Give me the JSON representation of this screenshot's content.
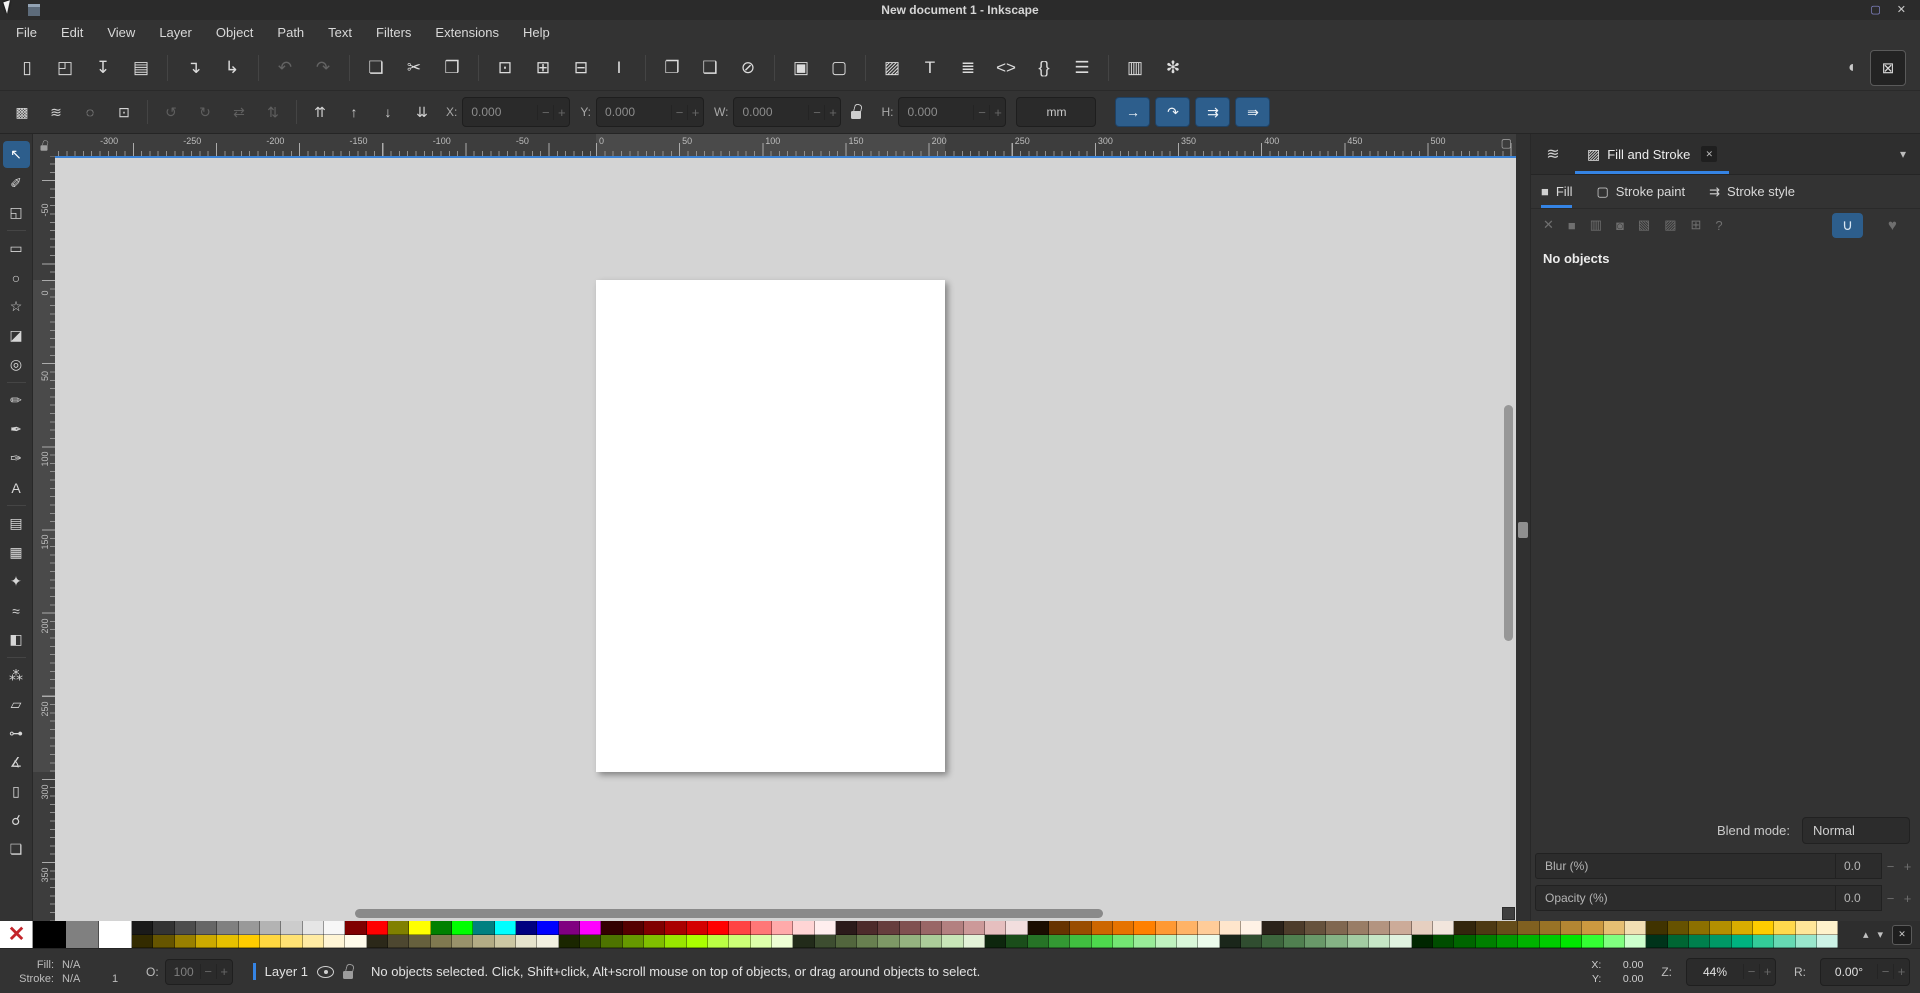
{
  "window": {
    "title": "New document 1 - Inkscape",
    "restore_icon": "▢",
    "close_icon": "✕"
  },
  "menubar": {
    "items": [
      "File",
      "Edit",
      "View",
      "Layer",
      "Object",
      "Path",
      "Text",
      "Filters",
      "Extensions",
      "Help"
    ]
  },
  "ui_icons": {
    "minus": "−",
    "plus": "+"
  },
  "command_toolbar": {
    "groups": [
      [
        {
          "name": "new-document",
          "glyph": "▯"
        },
        {
          "name": "open",
          "glyph": "◰"
        },
        {
          "name": "save",
          "glyph": "↧"
        },
        {
          "name": "print",
          "glyph": "▤"
        }
      ],
      [
        {
          "name": "import",
          "glyph": "↴"
        },
        {
          "name": "export",
          "glyph": "↳"
        }
      ],
      [
        {
          "name": "undo",
          "glyph": "↶",
          "disabled": true
        },
        {
          "name": "redo",
          "glyph": "↷",
          "disabled": true
        }
      ],
      [
        {
          "name": "copy",
          "glyph": "❏"
        },
        {
          "name": "cut",
          "glyph": "✂"
        },
        {
          "name": "paste",
          "glyph": "❒"
        }
      ],
      [
        {
          "name": "zoom-selection",
          "glyph": "⊡"
        },
        {
          "name": "zoom-drawing",
          "glyph": "⊞"
        },
        {
          "name": "zoom-page",
          "glyph": "⊟"
        },
        {
          "name": "zoom-page-width",
          "glyph": "I"
        }
      ],
      [
        {
          "name": "duplicate",
          "glyph": "❐"
        },
        {
          "name": "clone",
          "glyph": "❑"
        },
        {
          "name": "unlink-clone",
          "glyph": "⊘"
        }
      ],
      [
        {
          "name": "group",
          "glyph": "▣"
        },
        {
          "name": "ungroup",
          "glyph": "▢"
        }
      ],
      [
        {
          "name": "fill-stroke-dialog",
          "glyph": "▨"
        },
        {
          "name": "text-dialog",
          "glyph": "T"
        },
        {
          "name": "layers-dialog",
          "glyph": "≣"
        },
        {
          "name": "xml-editor",
          "glyph": "<>"
        },
        {
          "name": "object-properties",
          "glyph": "{}"
        },
        {
          "name": "align-distribute",
          "glyph": "☰"
        }
      ],
      [
        {
          "name": "document-properties",
          "glyph": "▥"
        },
        {
          "name": "preferences",
          "glyph": "✻"
        }
      ]
    ],
    "snap_options_icon": "◖",
    "snap_toggle_icon": "⊠"
  },
  "tool_options": {
    "selection_buttons": [
      {
        "name": "select-all",
        "glyph": "▩"
      },
      {
        "name": "select-all-layers",
        "glyph": "≋"
      },
      {
        "name": "deselect",
        "glyph": "◌"
      },
      {
        "name": "selection-box",
        "glyph": "⊡"
      }
    ],
    "transform_buttons": [
      {
        "name": "rotate-ccw",
        "glyph": "↺",
        "disabled": true
      },
      {
        "name": "rotate-cw",
        "glyph": "↻",
        "disabled": true
      },
      {
        "name": "flip-horizontal",
        "glyph": "⇄",
        "disabled": true
      },
      {
        "name": "flip-vertical",
        "glyph": "⇅",
        "disabled": true
      }
    ],
    "zorder_buttons": [
      {
        "name": "raise-to-top",
        "glyph": "⇈"
      },
      {
        "name": "raise",
        "glyph": "↑"
      },
      {
        "name": "lower",
        "glyph": "↓"
      },
      {
        "name": "lower-to-bottom",
        "glyph": "⇊"
      }
    ],
    "fields": {
      "x": {
        "label": "X:",
        "value": "0.000"
      },
      "y": {
        "label": "Y:",
        "value": "0.000"
      },
      "w": {
        "label": "W:",
        "value": "0.000"
      },
      "h": {
        "label": "H:",
        "value": "0.000"
      }
    },
    "unit": "mm",
    "transform_toggles": [
      {
        "name": "scale-stroke-toggle",
        "glyph": "→"
      },
      {
        "name": "scale-corners-toggle",
        "glyph": "↷"
      },
      {
        "name": "move-gradients-toggle",
        "glyph": "⇉"
      },
      {
        "name": "move-patterns-toggle",
        "glyph": "⇛"
      }
    ]
  },
  "toolbox": {
    "separators_after": [
      2,
      7,
      11,
      16
    ],
    "tools": [
      {
        "name": "selector",
        "glyph": "↖",
        "active": true
      },
      {
        "name": "node-editor",
        "glyph": "✐"
      },
      {
        "name": "shape-builder",
        "glyph": "◱"
      },
      {
        "name": "rectangle",
        "glyph": "▭"
      },
      {
        "name": "ellipse",
        "glyph": "○"
      },
      {
        "name": "star",
        "glyph": "☆"
      },
      {
        "name": "box-3d",
        "glyph": "◪"
      },
      {
        "name": "spiral",
        "glyph": "◎"
      },
      {
        "name": "pencil",
        "glyph": "✏"
      },
      {
        "name": "pen",
        "glyph": "✒"
      },
      {
        "name": "calligraphy",
        "glyph": "✑"
      },
      {
        "name": "text",
        "glyph": "A"
      },
      {
        "name": "gradient",
        "glyph": "▤"
      },
      {
        "name": "mesh-gradient",
        "glyph": "▦"
      },
      {
        "name": "dropper",
        "glyph": "✦"
      },
      {
        "name": "tweak",
        "glyph": "≈"
      },
      {
        "name": "paint-bucket",
        "glyph": "◧"
      },
      {
        "name": "spray",
        "glyph": "⁂"
      },
      {
        "name": "eraser",
        "glyph": "▱"
      },
      {
        "name": "connector",
        "glyph": "⊶"
      },
      {
        "name": "measure",
        "glyph": "∡"
      },
      {
        "name": "page",
        "glyph": "▯"
      },
      {
        "name": "zoom",
        "glyph": "☌"
      },
      {
        "name": "pages",
        "glyph": "❏"
      }
    ]
  },
  "rulers": {
    "horizontal": [
      -300,
      -250,
      -200,
      -150,
      -100,
      -50,
      0,
      50,
      100,
      150,
      200,
      250,
      300,
      350,
      400,
      450,
      500
    ],
    "vertical": [
      -50,
      0,
      50,
      100,
      150,
      200,
      250,
      300,
      350
    ]
  },
  "canvas_controls": {
    "display_icon": "▢"
  },
  "dock": {
    "header": {
      "layers_tab_icon": "≋",
      "title": "Fill and Stroke",
      "title_icon": "▨",
      "close_icon": "✕",
      "collapse_icon": "▾"
    },
    "tabs": [
      {
        "label": "Fill",
        "icon": "■",
        "active": true
      },
      {
        "label": "Stroke paint",
        "icon": "▢",
        "active": false
      },
      {
        "label": "Stroke style",
        "icon": "⇉",
        "active": false
      }
    ],
    "paint_types": [
      {
        "name": "no-paint",
        "glyph": "✕"
      },
      {
        "name": "flat-color",
        "glyph": "■"
      },
      {
        "name": "linear-gradient",
        "glyph": "▥"
      },
      {
        "name": "radial-gradient",
        "glyph": "◙"
      },
      {
        "name": "pattern",
        "glyph": "▧"
      },
      {
        "name": "swatch",
        "glyph": "▨"
      },
      {
        "name": "mesh-gradient-paint",
        "glyph": "⊞"
      },
      {
        "name": "unknown-paint",
        "glyph": "?"
      }
    ],
    "fill_rule": {
      "even_odd_icon": "∪",
      "nonzero_icon": "♥"
    },
    "message": "No objects",
    "blend": {
      "label": "Blend mode:",
      "value": "Normal"
    },
    "blur": {
      "label": "Blur (%)",
      "value": "0.0"
    },
    "opacity": {
      "label": "Opacity (%)",
      "value": "0.0"
    }
  },
  "palette": {
    "none_icon": "✕",
    "big_swatches": [
      "#000000",
      "#808080",
      "#ffffff"
    ],
    "row_top": [
      "#1a1a1a",
      "#333333",
      "#4d4d4d",
      "#666666",
      "#808080",
      "#999999",
      "#b3b3b3",
      "#cccccc",
      "#e6e6e6",
      "#f7f7f7",
      "#800000",
      "#ff0000",
      "#808000",
      "#ffff00",
      "#008000",
      "#00ff00",
      "#008080",
      "#00ffff",
      "#000080",
      "#0000ff",
      "#800080",
      "#ff00ff",
      "#330000",
      "#550000",
      "#800000",
      "#aa0000",
      "#d40000",
      "#ff0000",
      "#ff4444",
      "#ff7777",
      "#ffaaaa",
      "#ffd5d5",
      "#ffeeee",
      "#2b1a1a",
      "#4d2b2b",
      "#663d3d",
      "#805050",
      "#996666",
      "#b38080",
      "#cc9999",
      "#e6bfbf",
      "#f2dede",
      "#1a0d00",
      "#663300",
      "#994d00",
      "#cc6600",
      "#e67300",
      "#ff8000",
      "#ff9933",
      "#ffb366",
      "#ffcc99",
      "#ffe6cc",
      "#fff2e6",
      "#2b221a",
      "#4d3c2b",
      "#66523d",
      "#806750",
      "#997d66",
      "#b39480",
      "#ccab99",
      "#e6cfc0",
      "#f2e6dd",
      "#33260d",
      "#4d3913",
      "#664d1a",
      "#806020",
      "#997326",
      "#b38633",
      "#cc9940",
      "#e6bf73",
      "#f2dfb3",
      "#403300",
      "#665200",
      "#8c7000",
      "#b38f00",
      "#d9ad00",
      "#ffcc00",
      "#ffd94d",
      "#ffe699",
      "#fff2cc"
    ],
    "row_bottom": [
      "#332b00",
      "#665500",
      "#998000",
      "#ccaa00",
      "#e6c000",
      "#ffcc00",
      "#ffd740",
      "#ffe273",
      "#ffeba3",
      "#fff5d5",
      "#fffbea",
      "#2b2819",
      "#4d4730",
      "#66603d",
      "#807950",
      "#99926b",
      "#b3ac85",
      "#ccc7a3",
      "#e6e3cc",
      "#f2f0e0",
      "#1a2600",
      "#334d00",
      "#4d7300",
      "#669900",
      "#80bf00",
      "#99e600",
      "#aaff00",
      "#bbff44",
      "#ccff77",
      "#ddffaa",
      "#eeffd5",
      "#222b1a",
      "#3d4d30",
      "#52663d",
      "#688050",
      "#7e9966",
      "#95b380",
      "#abcc99",
      "#c8e6b8",
      "#e3f2d8",
      "#0d260d",
      "#1a4d1a",
      "#267326",
      "#339933",
      "#40bf40",
      "#4dd94d",
      "#73e673",
      "#99ec99",
      "#bff2bf",
      "#d9f7d9",
      "#ecfbec",
      "#1a261a",
      "#304d30",
      "#3d663d",
      "#508050",
      "#699969",
      "#85b385",
      "#a3cca3",
      "#c6e6c6",
      "#e0f2e0",
      "#002600",
      "#004d00",
      "#006600",
      "#008000",
      "#009900",
      "#00b300",
      "#00cc00",
      "#00e600",
      "#33ff33",
      "#80ff80",
      "#ccffcc",
      "#00331a",
      "#006633",
      "#00804d",
      "#009966",
      "#00b380",
      "#33cc99",
      "#66d9b3",
      "#99e6cc",
      "#ccf2e6"
    ],
    "scroll_up_icon": "▴",
    "scroll_down_icon": "▾",
    "config_icon": "✕"
  },
  "statusbar": {
    "fill_label": "Fill:",
    "fill_value": "N/A",
    "stroke_label": "Stroke:",
    "stroke_value": "N/A",
    "stroke_width": "1",
    "opacity_label": "O:",
    "opacity_value": "100",
    "layer_name": "Layer 1",
    "message": "No objects selected. Click, Shift+click, Alt+scroll mouse on top of objects, or drag around objects to select.",
    "x_label": "X:",
    "x_value": "0.00",
    "y_label": "Y:",
    "y_value": "0.00",
    "zoom_label": "Z:",
    "zoom_value": "44%",
    "rotation_label": "R:",
    "rotation_value": "0.00°"
  }
}
